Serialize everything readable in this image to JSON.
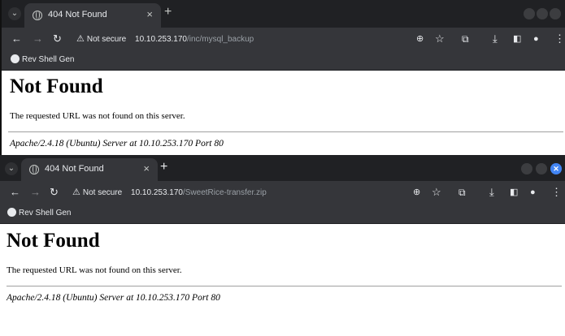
{
  "windows": [
    {
      "tab_title": "404 Not Found",
      "address": {
        "security": "Not secure",
        "host": "10.10.253.170",
        "path": "/inc/mysql_backup"
      },
      "bookmark": "Rev Shell Gen",
      "page": {
        "heading": "Not Found",
        "message": "The requested URL was not found on this server.",
        "server_signature": "Apache/2.4.18 (Ubuntu) Server at 10.10.253.170 Port 80"
      }
    },
    {
      "tab_title": "404 Not Found",
      "address": {
        "security": "Not secure",
        "host": "10.10.253.170",
        "path": "/SweetRice-transfer.zip"
      },
      "bookmark": "Rev Shell Gen",
      "page": {
        "heading": "Not Found",
        "message": "The requested URL was not found on this server.",
        "server_signature": "Apache/2.4.18 (Ubuntu) Server at 10.10.253.170 Port 80"
      }
    }
  ],
  "icons": {
    "tab_dropdown": "chevron-down-icon",
    "tab_favicon": "globe-icon",
    "tab_close": "close-icon",
    "new_tab": "plus-icon",
    "back": "back-arrow-icon",
    "forward": "forward-arrow-icon",
    "reload": "reload-icon",
    "security": "warning-triangle-icon",
    "zoom": "zoom-icon",
    "bookmark_star": "star-icon",
    "extensions": "puzzle-icon",
    "download": "download-icon",
    "sidepanel": "side-panel-icon",
    "profile": "profile-icon",
    "menu": "kebab-menu-icon",
    "bookmark_favicon": "skull-icon"
  },
  "colors": {
    "chrome_dark": "#202124",
    "toolbar": "#35363a",
    "close_accent": "#4285f4",
    "page_bg": "#ffffff"
  }
}
